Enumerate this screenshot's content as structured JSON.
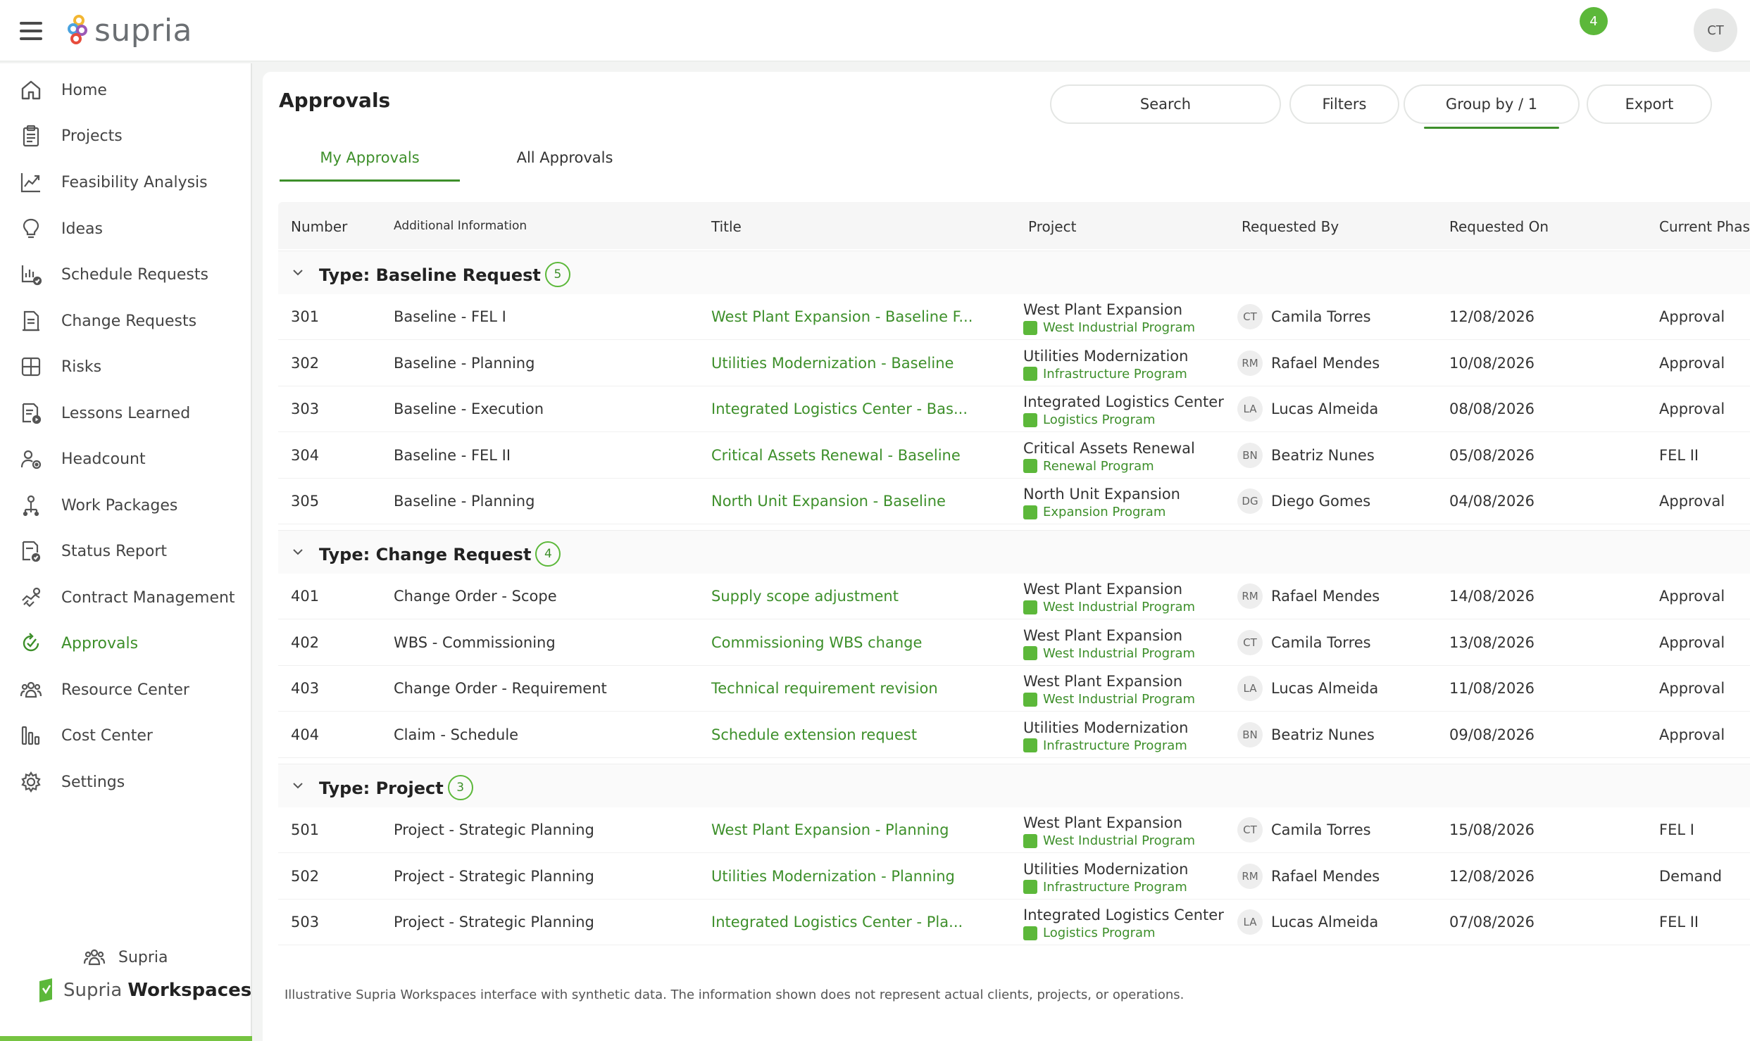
{
  "header": {
    "brand": "supria",
    "notification_count": "4",
    "user_initials": "CT"
  },
  "sidebar": {
    "items": [
      {
        "label": "Home",
        "icon": "home-icon"
      },
      {
        "label": "Projects",
        "icon": "clipboard-icon"
      },
      {
        "label": "Feasibility Analysis",
        "icon": "trend-chart-icon"
      },
      {
        "label": "Ideas",
        "icon": "lightbulb-icon"
      },
      {
        "label": "Schedule Requests",
        "icon": "schedule-check-icon"
      },
      {
        "label": "Change Requests",
        "icon": "document-edit-icon"
      },
      {
        "label": "Risks",
        "icon": "grid-panel-icon"
      },
      {
        "label": "Lessons Learned",
        "icon": "document-play-icon"
      },
      {
        "label": "Headcount",
        "icon": "people-settings-icon"
      },
      {
        "label": "Work Packages",
        "icon": "person-hierarchy-icon"
      },
      {
        "label": "Status Report",
        "icon": "document-check-icon"
      },
      {
        "label": "Contract Management",
        "icon": "handshake-icon"
      },
      {
        "label": "Approvals",
        "icon": "check-cycle-icon"
      },
      {
        "label": "Resource Center",
        "icon": "people-group-icon"
      },
      {
        "label": "Cost Center",
        "icon": "bar-columns-icon"
      },
      {
        "label": "Settings",
        "icon": "gear-icon"
      }
    ],
    "active": "Approvals",
    "footer_user": "Supria",
    "footer_brand_a": "Supria",
    "footer_brand_b": "Workspaces"
  },
  "main": {
    "title": "Approvals",
    "actions": {
      "search": "Search",
      "filters": "Filters",
      "group_by": "Group by / 1",
      "export": "Export"
    },
    "tabs": [
      {
        "label": "My Approvals"
      },
      {
        "label": "All Approvals"
      }
    ],
    "columns": [
      "Number",
      "Additional Information",
      "Title",
      "Project",
      "Requested By",
      "Requested On",
      "Current Phas"
    ],
    "groups": [
      {
        "title": "Type: Baseline Request",
        "count": "5",
        "rows": [
          {
            "number": "301",
            "info": "Baseline - FEL I",
            "title": "West Plant Expansion - Baseline F...",
            "project": "West Plant Expansion",
            "program": "West Industrial Program",
            "initials": "CT",
            "requested_by": "Camila Torres",
            "requested_on": "12/08/2026",
            "phase": "Approval"
          },
          {
            "number": "302",
            "info": "Baseline - Planning",
            "title": "Utilities Modernization - Baseline",
            "project": "Utilities Modernization",
            "program": "Infrastructure Program",
            "initials": "RM",
            "requested_by": "Rafael Mendes",
            "requested_on": "10/08/2026",
            "phase": "Approval"
          },
          {
            "number": "303",
            "info": "Baseline - Execution",
            "title": "Integrated Logistics Center - Bas...",
            "project": "Integrated Logistics Center",
            "program": "Logistics Program",
            "initials": "LA",
            "requested_by": "Lucas Almeida",
            "requested_on": "08/08/2026",
            "phase": "Approval"
          },
          {
            "number": "304",
            "info": "Baseline - FEL II",
            "title": "Critical Assets Renewal - Baseline",
            "project": "Critical Assets Renewal",
            "program": "Renewal Program",
            "initials": "BN",
            "requested_by": "Beatriz Nunes",
            "requested_on": "05/08/2026",
            "phase": "FEL II"
          },
          {
            "number": "305",
            "info": "Baseline - Planning",
            "title": "North Unit Expansion - Baseline",
            "project": "North Unit Expansion",
            "program": "Expansion Program",
            "initials": "DG",
            "requested_by": "Diego Gomes",
            "requested_on": "04/08/2026",
            "phase": "Approval"
          }
        ]
      },
      {
        "title": "Type: Change Request",
        "count": "4",
        "rows": [
          {
            "number": "401",
            "info": "Change Order - Scope",
            "title": "Supply scope adjustment",
            "project": "West Plant Expansion",
            "program": "West Industrial Program",
            "initials": "RM",
            "requested_by": "Rafael Mendes",
            "requested_on": "14/08/2026",
            "phase": "Approval"
          },
          {
            "number": "402",
            "info": "WBS - Commissioning",
            "title": "Commissioning WBS change",
            "project": "West Plant Expansion",
            "program": "West Industrial Program",
            "initials": "CT",
            "requested_by": "Camila Torres",
            "requested_on": "13/08/2026",
            "phase": "Approval"
          },
          {
            "number": "403",
            "info": "Change Order - Requirement",
            "title": "Technical requirement revision",
            "project": "West Plant Expansion",
            "program": "West Industrial Program",
            "initials": "LA",
            "requested_by": "Lucas Almeida",
            "requested_on": "11/08/2026",
            "phase": "Approval"
          },
          {
            "number": "404",
            "info": "Claim - Schedule",
            "title": "Schedule extension request",
            "project": "Utilities Modernization",
            "program": "Infrastructure Program",
            "initials": "BN",
            "requested_by": "Beatriz Nunes",
            "requested_on": "09/08/2026",
            "phase": "Approval"
          }
        ]
      },
      {
        "title": "Type: Project",
        "count": "3",
        "rows": [
          {
            "number": "501",
            "info": "Project - Strategic Planning",
            "title": "West Plant Expansion - Planning",
            "project": "West Plant Expansion",
            "program": "West Industrial Program",
            "initials": "CT",
            "requested_by": "Camila Torres",
            "requested_on": "15/08/2026",
            "phase": "FEL I"
          },
          {
            "number": "502",
            "info": "Project - Strategic Planning",
            "title": "Utilities Modernization - Planning",
            "project": "Utilities Modernization",
            "program": "Infrastructure Program",
            "initials": "RM",
            "requested_by": "Rafael Mendes",
            "requested_on": "12/08/2026",
            "phase": "Demand"
          },
          {
            "number": "503",
            "info": "Project - Strategic Planning",
            "title": "Integrated Logistics Center - Pla...",
            "project": "Integrated Logistics Center",
            "program": "Logistics Program",
            "initials": "LA",
            "requested_by": "Lucas Almeida",
            "requested_on": "07/08/2026",
            "phase": "FEL II"
          }
        ]
      }
    ],
    "disclaimer": "Illustrative Supria Workspaces interface with synthetic data. The information shown does not represent actual clients, projects, or operations."
  },
  "colors": {
    "accent": "#3d8f2a",
    "accent_light": "#5cb83a",
    "brand_bar": "#76c442"
  }
}
